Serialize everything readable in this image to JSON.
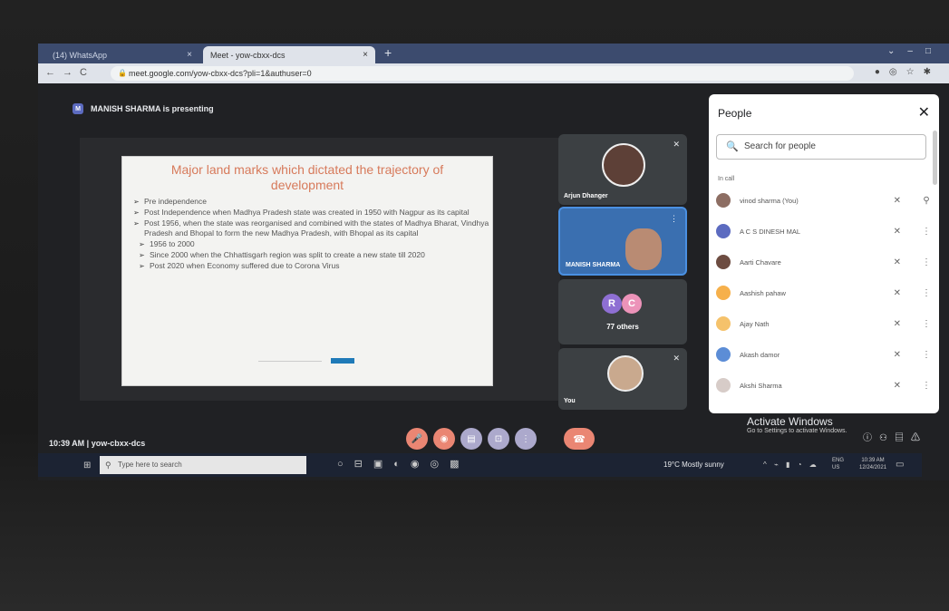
{
  "browser": {
    "tab1_label": "(14) WhatsApp",
    "tab2_label": "Meet - yow-cbxx-dcs",
    "new_tab": "+",
    "url": "meet.google.com/yow-cbxx-dcs?pli=1&authuser=0"
  },
  "meet": {
    "presenter_initial": "M",
    "presenting_text": "MANISH SHARMA is presenting",
    "time_code": "10:39 AM  |  yow-cbxx-dcs"
  },
  "slide": {
    "title": "Major land marks which dictated the trajectory of development",
    "bullets": [
      "Pre independence",
      "Post Independence when Madhya Pradesh state was created in 1950 with Nagpur as its capital",
      "Post 1956, when the state was reorganised and combined with the states of Madhya Bharat, Vindhya Pradesh and Bhopal to form the new Madhya Pradesh, with Bhopal as its capital",
      "1956 to 2000",
      "Since 2000 when the Chhattisgarh region was split to create a new state till 2020",
      "Post 2020 when Economy suffered due to Corona Virus"
    ]
  },
  "tiles": {
    "tile1_name": "Arjun Dhanger",
    "tile2_name": "MANISH SHARMA",
    "tile3_initial_r": "R",
    "tile3_initial_c": "C",
    "tile3_others": "77 others",
    "tile4_name": "You"
  },
  "people": {
    "title": "People",
    "close": "✕",
    "search_placeholder": "Search for people",
    "section_label": "In call",
    "participants": [
      {
        "name": "vinod sharma (You)",
        "color": "#8d6e63"
      },
      {
        "name": "A C S DINESH MAL",
        "color": "#5c6bc0"
      },
      {
        "name": "Aarti Chavare",
        "color": "#6d4c41"
      },
      {
        "name": "Aashish pahaw",
        "color": "#f6b04b"
      },
      {
        "name": "Ajay Nath",
        "color": "#f5c26b"
      },
      {
        "name": "Akash damor",
        "color": "#5c8dd6"
      },
      {
        "name": "Akshi Sharma",
        "color": "#d7ccc8"
      }
    ]
  },
  "watermark": {
    "line1": "Activate Windows",
    "line2": "Go to Settings to activate Windows."
  },
  "taskbar": {
    "search_placeholder": "Type here to search",
    "weather": "19°C  Mostly sunny",
    "lang_line1": "ENG",
    "lang_line2": "US",
    "clock_time": "10:39 AM",
    "clock_date": "12/24/2021"
  }
}
